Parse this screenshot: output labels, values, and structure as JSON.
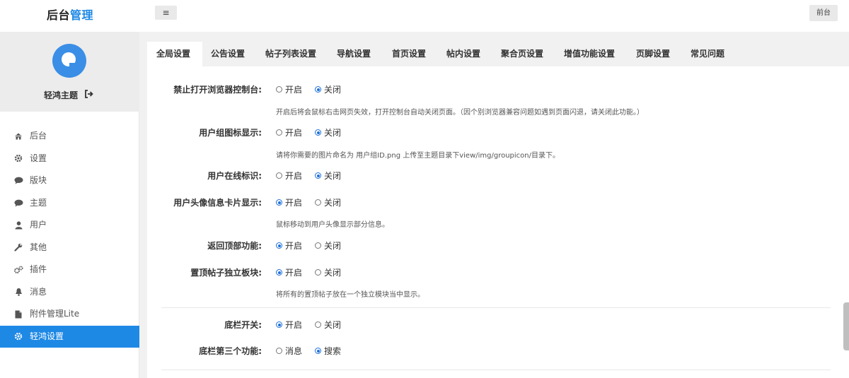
{
  "header": {
    "brand_main": "后台",
    "brand_accent": "管理",
    "menu_toggle": "≡",
    "front_button": "前台"
  },
  "profile": {
    "name": "轻鸿主题"
  },
  "sidebar": {
    "items": [
      {
        "label": "后台",
        "icon": "home-icon"
      },
      {
        "label": "设置",
        "icon": "gear-icon"
      },
      {
        "label": "版块",
        "icon": "comment-icon"
      },
      {
        "label": "主题",
        "icon": "comment-icon"
      },
      {
        "label": "用户",
        "icon": "user-icon"
      },
      {
        "label": "其他",
        "icon": "wrench-icon"
      },
      {
        "label": "插件",
        "icon": "gears-icon"
      },
      {
        "label": "消息",
        "icon": "bell-icon"
      },
      {
        "label": "附件管理Lite",
        "icon": "file-icon"
      },
      {
        "label": "轻鸿设置",
        "icon": "gear-icon",
        "active": true
      }
    ]
  },
  "tabs": [
    "全局设置",
    "公告设置",
    "帖子列表设置",
    "导航设置",
    "首页设置",
    "帖内设置",
    "聚合页设置",
    "增值功能设置",
    "页脚设置",
    "常见问题"
  ],
  "settings": [
    {
      "label": "禁止打开浏览器控制台:",
      "opt1": "开启",
      "opt2": "关闭",
      "selected": 2,
      "hint": "开启后将会鼠标右击网页失效，打开控制台自动关闭页面。（因个别浏览器兼容问题如遇到页面闪退，请关闭此功能。）"
    },
    {
      "label": "用户组图标显示:",
      "opt1": "开启",
      "opt2": "关闭",
      "selected": 2,
      "hint": "请将你需要的图片命名为 用户组ID.png 上传至主题目录下view/img/groupicon/目录下。"
    },
    {
      "label": "用户在线标识:",
      "opt1": "开启",
      "opt2": "关闭",
      "selected": 2,
      "hint": ""
    },
    {
      "label": "用户头像信息卡片显示:",
      "opt1": "开启",
      "opt2": "关闭",
      "selected": 1,
      "hint": "鼠标移动到用户头像显示部分信息。"
    },
    {
      "label": "返回顶部功能:",
      "opt1": "开启",
      "opt2": "关闭",
      "selected": 1,
      "hint": ""
    },
    {
      "label": "置顶帖子独立板块:",
      "opt1": "开启",
      "opt2": "关闭",
      "selected": 1,
      "hint": "将所有的置顶帖子放在一个独立模块当中显示。"
    },
    {
      "label": "底栏开关:",
      "opt1": "开启",
      "opt2": "关闭",
      "selected": 1,
      "hint": ""
    },
    {
      "label": "底栏第三个功能:",
      "opt1": "消息",
      "opt2": "搜索",
      "selected": 2,
      "hint": ""
    }
  ],
  "colors": {
    "accent": "#1e88e5",
    "page_bg": "#f1f1f1"
  }
}
